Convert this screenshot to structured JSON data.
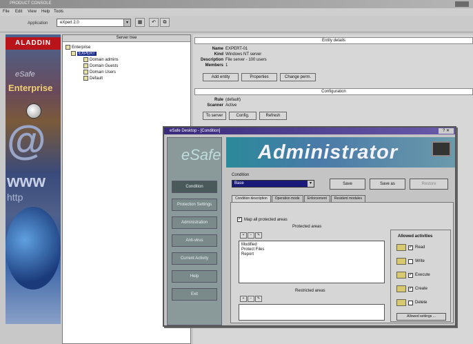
{
  "window": {
    "title": "PRODUCT CONSOLE",
    "menu": [
      "File",
      "Edit",
      "View",
      "Help",
      "Tools"
    ]
  },
  "toolbar": {
    "application_label": "Application",
    "application_value": "eXpert 2.0",
    "buttons": [
      "▦",
      "↶",
      "⧉"
    ]
  },
  "banner": {
    "logo": "ALADDIN",
    "subtitle": "eSafe",
    "title": "Enterprise",
    "at": "@",
    "www": "www",
    "http": "http"
  },
  "tree": {
    "header": "Server tree",
    "nodes": [
      {
        "label": "Enterprise",
        "indent": 0,
        "selected": false
      },
      {
        "label": "EXPERT",
        "indent": 1,
        "selected": true
      },
      {
        "label": "Domain admins",
        "indent": 2,
        "selected": false
      },
      {
        "label": "Domain Guests",
        "indent": 2,
        "selected": false
      },
      {
        "label": "Domain Users",
        "indent": 2,
        "selected": false
      },
      {
        "label": "Default",
        "indent": 2,
        "selected": false
      }
    ]
  },
  "detail": {
    "entity_header": "Entity details",
    "fields": [
      {
        "key": "Name",
        "value": "EXPERT-01"
      },
      {
        "key": "Kind",
        "value": "Windows NT server"
      },
      {
        "key": "Description",
        "value": "File server - 100 users"
      },
      {
        "key": "Members",
        "value": "1"
      }
    ],
    "entity_buttons": [
      "Add entity",
      "Properties",
      "Change perm."
    ],
    "config_header": "Configuration",
    "config_fields": [
      {
        "key": "Rule",
        "value": "(default)"
      },
      {
        "key": "Scanner",
        "value": "Active"
      }
    ],
    "config_buttons": [
      "To server",
      "Config.",
      "Refresh"
    ]
  },
  "dialog": {
    "title": "eSafe Desktop - [Condition]",
    "close_label": "? ✕",
    "banner_text": "Administrator",
    "side_logo": "eSafe",
    "side_buttons": [
      {
        "label": "Condition",
        "active": true
      },
      {
        "label": "Protection Settings",
        "active": false
      },
      {
        "label": "Administration",
        "active": false
      },
      {
        "label": "Anti-virus",
        "active": false
      },
      {
        "label": "Current Activity",
        "active": false
      },
      {
        "label": "Help",
        "active": false
      },
      {
        "label": "Exit",
        "active": false
      }
    ],
    "condition_label": "Condition",
    "condition_value": "Base",
    "buttons": [
      "Save",
      "Save as",
      "Restore"
    ],
    "tabs": [
      {
        "label": "Condition description",
        "active": true
      },
      {
        "label": "Operation mode",
        "active": false
      },
      {
        "label": "Enforcement",
        "active": false
      },
      {
        "label": "Resident modules",
        "active": false
      }
    ],
    "apply_all": "Map all protected areas",
    "protected_label": "Protected areas",
    "protected_items": [
      "Modified",
      "Protect Files",
      "Report"
    ],
    "restricted_label": "Restricted areas",
    "allowed_title": "Allowed activities",
    "allowed": [
      {
        "label": "Read",
        "checked": true
      },
      {
        "label": "Write",
        "checked": false
      },
      {
        "label": "Execute",
        "checked": true
      },
      {
        "label": "Create",
        "checked": true
      },
      {
        "label": "Delete",
        "checked": false
      }
    ],
    "restrict_button": "Allowed settings ..."
  }
}
